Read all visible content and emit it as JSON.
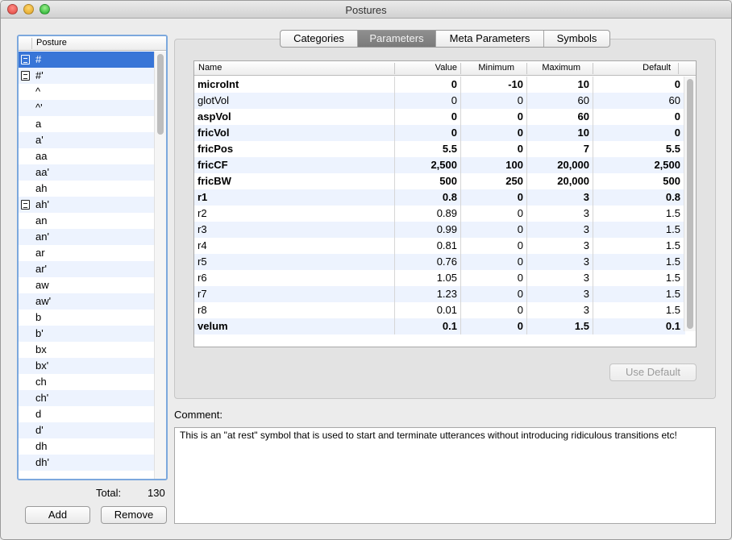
{
  "window": {
    "title": "Postures"
  },
  "posture_list": {
    "column_header": "Posture",
    "selected_index": 0,
    "items": [
      {
        "label": "#",
        "note": true
      },
      {
        "label": "#'",
        "note": true
      },
      {
        "label": "^",
        "note": false
      },
      {
        "label": "^'",
        "note": false
      },
      {
        "label": "a",
        "note": false
      },
      {
        "label": "a'",
        "note": false
      },
      {
        "label": "aa",
        "note": false
      },
      {
        "label": "aa'",
        "note": false
      },
      {
        "label": "ah",
        "note": false
      },
      {
        "label": "ah'",
        "note": true
      },
      {
        "label": "an",
        "note": false
      },
      {
        "label": "an'",
        "note": false
      },
      {
        "label": "ar",
        "note": false
      },
      {
        "label": "ar'",
        "note": false
      },
      {
        "label": "aw",
        "note": false
      },
      {
        "label": "aw'",
        "note": false
      },
      {
        "label": "b",
        "note": false
      },
      {
        "label": "b'",
        "note": false
      },
      {
        "label": "bx",
        "note": false
      },
      {
        "label": "bx'",
        "note": false
      },
      {
        "label": "ch",
        "note": false
      },
      {
        "label": "ch'",
        "note": false
      },
      {
        "label": "d",
        "note": false
      },
      {
        "label": "d'",
        "note": false
      },
      {
        "label": "dh",
        "note": false
      },
      {
        "label": "dh'",
        "note": false
      }
    ],
    "note_icon": "note-icon"
  },
  "footer": {
    "total_label": "Total:",
    "total_value": "130",
    "add_label": "Add",
    "remove_label": "Remove"
  },
  "tabs": [
    {
      "label": "Categories",
      "active": false
    },
    {
      "label": "Parameters",
      "active": true
    },
    {
      "label": "Meta Parameters",
      "active": false
    },
    {
      "label": "Symbols",
      "active": false
    }
  ],
  "parameters_table": {
    "columns": [
      "Name",
      "Value",
      "Minimum",
      "Maximum",
      "Default"
    ],
    "rows": [
      {
        "name": "microInt",
        "value": "0",
        "minimum": "-10",
        "maximum": "10",
        "default": "0",
        "bold": true
      },
      {
        "name": "glotVol",
        "value": "0",
        "minimum": "0",
        "maximum": "60",
        "default": "60",
        "bold": false
      },
      {
        "name": "aspVol",
        "value": "0",
        "minimum": "0",
        "maximum": "60",
        "default": "0",
        "bold": true
      },
      {
        "name": "fricVol",
        "value": "0",
        "minimum": "0",
        "maximum": "10",
        "default": "0",
        "bold": true
      },
      {
        "name": "fricPos",
        "value": "5.5",
        "minimum": "0",
        "maximum": "7",
        "default": "5.5",
        "bold": true
      },
      {
        "name": "fricCF",
        "value": "2,500",
        "minimum": "100",
        "maximum": "20,000",
        "default": "2,500",
        "bold": true
      },
      {
        "name": "fricBW",
        "value": "500",
        "minimum": "250",
        "maximum": "20,000",
        "default": "500",
        "bold": true
      },
      {
        "name": "r1",
        "value": "0.8",
        "minimum": "0",
        "maximum": "3",
        "default": "0.8",
        "bold": true
      },
      {
        "name": "r2",
        "value": "0.89",
        "minimum": "0",
        "maximum": "3",
        "default": "1.5",
        "bold": false
      },
      {
        "name": "r3",
        "value": "0.99",
        "minimum": "0",
        "maximum": "3",
        "default": "1.5",
        "bold": false
      },
      {
        "name": "r4",
        "value": "0.81",
        "minimum": "0",
        "maximum": "3",
        "default": "1.5",
        "bold": false
      },
      {
        "name": "r5",
        "value": "0.76",
        "minimum": "0",
        "maximum": "3",
        "default": "1.5",
        "bold": false
      },
      {
        "name": "r6",
        "value": "1.05",
        "minimum": "0",
        "maximum": "3",
        "default": "1.5",
        "bold": false
      },
      {
        "name": "r7",
        "value": "1.23",
        "minimum": "0",
        "maximum": "3",
        "default": "1.5",
        "bold": false
      },
      {
        "name": "r8",
        "value": "0.01",
        "minimum": "0",
        "maximum": "3",
        "default": "1.5",
        "bold": false
      },
      {
        "name": "velum",
        "value": "0.1",
        "minimum": "0",
        "maximum": "1.5",
        "default": "0.1",
        "bold": true
      }
    ]
  },
  "use_default_label": "Use Default",
  "comment": {
    "label": "Comment:",
    "text": "This is an \"at rest\" symbol that is used to start and terminate utterances without introducing ridiculous transitions etc!"
  },
  "colors": {
    "selection": "#3875d7",
    "focus_ring": "#7ca8dd",
    "alt_row": "#edf3fe"
  }
}
